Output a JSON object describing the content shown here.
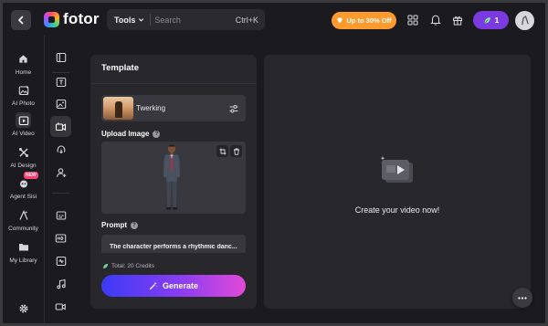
{
  "header": {
    "brand": "fotor",
    "tools_label": "Tools",
    "search_placeholder": "Search",
    "search_shortcut": "Ctrl+K",
    "promo": "Up to 30% Off",
    "credits": "1"
  },
  "sidebar": {
    "items": [
      {
        "label": "Home",
        "icon": "home-icon"
      },
      {
        "label": "AI Photo",
        "icon": "ai-photo-icon"
      },
      {
        "label": "AI Video",
        "icon": "ai-video-icon"
      },
      {
        "label": "AI Design",
        "icon": "ai-design-icon"
      },
      {
        "label": "Agent Sisi",
        "icon": "agent-icon",
        "badge": "NEW"
      },
      {
        "label": "Community",
        "icon": "community-icon"
      },
      {
        "label": "My Library",
        "icon": "folder-icon"
      }
    ],
    "settings_icon": "gear-icon"
  },
  "template_panel": {
    "title": "Template",
    "template_name": "Twerking",
    "upload_label": "Upload Image",
    "prompt_label": "Prompt",
    "prompt_text": "The character performs a rhythmic danc...",
    "credits_text": "Total: 20 Credits",
    "generate_label": "Generate"
  },
  "preview": {
    "message": "Create your video now!"
  },
  "colors": {
    "background": "#1b1b1f",
    "panel": "#27272c",
    "promo": "#ff9a2e",
    "credits_pill": "#7a3ae0",
    "generate_gradient_start": "#3b3bf5",
    "generate_gradient_end": "#e24ad8"
  }
}
